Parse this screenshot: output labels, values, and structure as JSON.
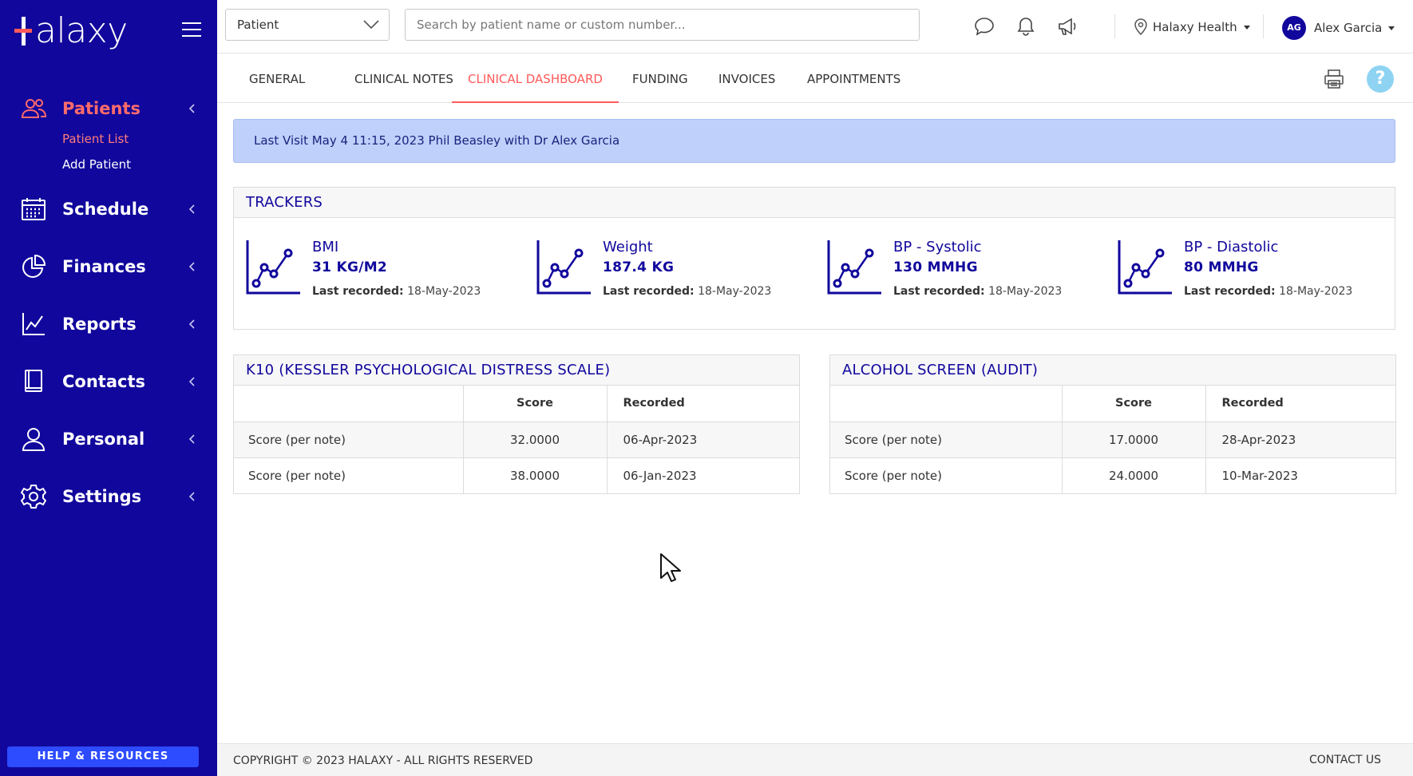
{
  "app": {
    "name": "Halaxy",
    "logo_text": "alaxy"
  },
  "colors": {
    "sidebar": "#11079c",
    "accent": "#ff5a5a",
    "banner": "#bfd0fb",
    "help_button": "#2d4bff",
    "heading": "#11079c"
  },
  "sidebar": {
    "items": [
      {
        "label": "Patients",
        "icon": "patients-icon",
        "active": true
      },
      {
        "label": "Schedule",
        "icon": "calendar-icon"
      },
      {
        "label": "Finances",
        "icon": "pie-chart-icon"
      },
      {
        "label": "Reports",
        "icon": "line-chart-icon"
      },
      {
        "label": "Contacts",
        "icon": "book-icon"
      },
      {
        "label": "Personal",
        "icon": "person-icon"
      },
      {
        "label": "Settings",
        "icon": "gear-icon"
      }
    ],
    "patients_sub": [
      {
        "label": "Patient List",
        "current": true
      },
      {
        "label": "Add Patient"
      }
    ],
    "help_label": "HELP & RESOURCES"
  },
  "topbar": {
    "patient_select": "Patient",
    "search_placeholder": "Search by patient name or custom number...",
    "icons": [
      "chat-icon",
      "bell-icon",
      "megaphone-icon"
    ],
    "location": "Halaxy Health",
    "user": {
      "initials": "AG",
      "name": "Alex Garcia"
    }
  },
  "tabs": [
    {
      "label": "GENERAL"
    },
    {
      "label": "CLINICAL NOTES"
    },
    {
      "label": "CLINICAL DASHBOARD",
      "active": true
    },
    {
      "label": "FUNDING"
    },
    {
      "label": "INVOICES"
    },
    {
      "label": "APPOINTMENTS"
    }
  ],
  "help_icon_label": "?",
  "last_visit": "Last Visit May 4 11:15, 2023 Phil Beasley with Dr Alex Garcia",
  "trackers": {
    "title": "TRACKERS",
    "last_label": "Last recorded:",
    "items": [
      {
        "name": "BMI",
        "value": "31 KG/M2",
        "date": "18-May-2023"
      },
      {
        "name": "Weight",
        "value": "187.4 KG",
        "date": "18-May-2023"
      },
      {
        "name": "BP - Systolic",
        "value": "130 MMHG",
        "date": "18-May-2023"
      },
      {
        "name": "BP - Diastolic",
        "value": "80 MMHG",
        "date": "18-May-2023"
      }
    ]
  },
  "k10": {
    "title": "K10 (KESSLER PSYCHOLOGICAL DISTRESS SCALE)",
    "columns": [
      "",
      "Score",
      "Recorded"
    ],
    "rows": [
      [
        "Score (per note)",
        "32.0000",
        "06-Apr-2023"
      ],
      [
        "Score (per note)",
        "38.0000",
        "06-Jan-2023"
      ]
    ]
  },
  "audit": {
    "title": "ALCOHOL SCREEN (AUDIT)",
    "columns": [
      "",
      "Score",
      "Recorded"
    ],
    "rows": [
      [
        "Score (per note)",
        "17.0000",
        "28-Apr-2023"
      ],
      [
        "Score (per note)",
        "24.0000",
        "10-Mar-2023"
      ]
    ]
  },
  "footer": {
    "copyright": "COPYRIGHT © 2023 HALAXY - ALL RIGHTS RESERVED",
    "contact": "CONTACT US"
  }
}
